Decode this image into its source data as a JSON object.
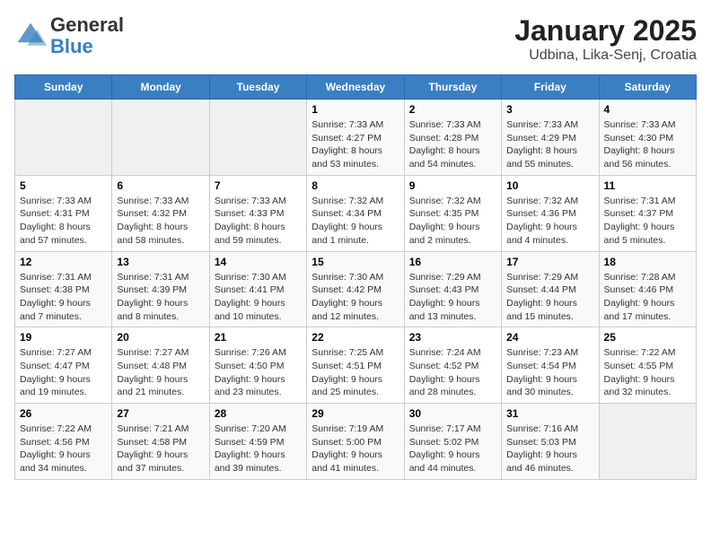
{
  "header": {
    "logo_general": "General",
    "logo_blue": "Blue",
    "title": "January 2025",
    "subtitle": "Udbina, Lika-Senj, Croatia"
  },
  "weekdays": [
    "Sunday",
    "Monday",
    "Tuesday",
    "Wednesday",
    "Thursday",
    "Friday",
    "Saturday"
  ],
  "weeks": [
    [
      {
        "day": "",
        "info": ""
      },
      {
        "day": "",
        "info": ""
      },
      {
        "day": "",
        "info": ""
      },
      {
        "day": "1",
        "info": "Sunrise: 7:33 AM\nSunset: 4:27 PM\nDaylight: 8 hours and 53 minutes."
      },
      {
        "day": "2",
        "info": "Sunrise: 7:33 AM\nSunset: 4:28 PM\nDaylight: 8 hours and 54 minutes."
      },
      {
        "day": "3",
        "info": "Sunrise: 7:33 AM\nSunset: 4:29 PM\nDaylight: 8 hours and 55 minutes."
      },
      {
        "day": "4",
        "info": "Sunrise: 7:33 AM\nSunset: 4:30 PM\nDaylight: 8 hours and 56 minutes."
      }
    ],
    [
      {
        "day": "5",
        "info": "Sunrise: 7:33 AM\nSunset: 4:31 PM\nDaylight: 8 hours and 57 minutes."
      },
      {
        "day": "6",
        "info": "Sunrise: 7:33 AM\nSunset: 4:32 PM\nDaylight: 8 hours and 58 minutes."
      },
      {
        "day": "7",
        "info": "Sunrise: 7:33 AM\nSunset: 4:33 PM\nDaylight: 8 hours and 59 minutes."
      },
      {
        "day": "8",
        "info": "Sunrise: 7:32 AM\nSunset: 4:34 PM\nDaylight: 9 hours and 1 minute."
      },
      {
        "day": "9",
        "info": "Sunrise: 7:32 AM\nSunset: 4:35 PM\nDaylight: 9 hours and 2 minutes."
      },
      {
        "day": "10",
        "info": "Sunrise: 7:32 AM\nSunset: 4:36 PM\nDaylight: 9 hours and 4 minutes."
      },
      {
        "day": "11",
        "info": "Sunrise: 7:31 AM\nSunset: 4:37 PM\nDaylight: 9 hours and 5 minutes."
      }
    ],
    [
      {
        "day": "12",
        "info": "Sunrise: 7:31 AM\nSunset: 4:38 PM\nDaylight: 9 hours and 7 minutes."
      },
      {
        "day": "13",
        "info": "Sunrise: 7:31 AM\nSunset: 4:39 PM\nDaylight: 9 hours and 8 minutes."
      },
      {
        "day": "14",
        "info": "Sunrise: 7:30 AM\nSunset: 4:41 PM\nDaylight: 9 hours and 10 minutes."
      },
      {
        "day": "15",
        "info": "Sunrise: 7:30 AM\nSunset: 4:42 PM\nDaylight: 9 hours and 12 minutes."
      },
      {
        "day": "16",
        "info": "Sunrise: 7:29 AM\nSunset: 4:43 PM\nDaylight: 9 hours and 13 minutes."
      },
      {
        "day": "17",
        "info": "Sunrise: 7:29 AM\nSunset: 4:44 PM\nDaylight: 9 hours and 15 minutes."
      },
      {
        "day": "18",
        "info": "Sunrise: 7:28 AM\nSunset: 4:46 PM\nDaylight: 9 hours and 17 minutes."
      }
    ],
    [
      {
        "day": "19",
        "info": "Sunrise: 7:27 AM\nSunset: 4:47 PM\nDaylight: 9 hours and 19 minutes."
      },
      {
        "day": "20",
        "info": "Sunrise: 7:27 AM\nSunset: 4:48 PM\nDaylight: 9 hours and 21 minutes."
      },
      {
        "day": "21",
        "info": "Sunrise: 7:26 AM\nSunset: 4:50 PM\nDaylight: 9 hours and 23 minutes."
      },
      {
        "day": "22",
        "info": "Sunrise: 7:25 AM\nSunset: 4:51 PM\nDaylight: 9 hours and 25 minutes."
      },
      {
        "day": "23",
        "info": "Sunrise: 7:24 AM\nSunset: 4:52 PM\nDaylight: 9 hours and 28 minutes."
      },
      {
        "day": "24",
        "info": "Sunrise: 7:23 AM\nSunset: 4:54 PM\nDaylight: 9 hours and 30 minutes."
      },
      {
        "day": "25",
        "info": "Sunrise: 7:22 AM\nSunset: 4:55 PM\nDaylight: 9 hours and 32 minutes."
      }
    ],
    [
      {
        "day": "26",
        "info": "Sunrise: 7:22 AM\nSunset: 4:56 PM\nDaylight: 9 hours and 34 minutes."
      },
      {
        "day": "27",
        "info": "Sunrise: 7:21 AM\nSunset: 4:58 PM\nDaylight: 9 hours and 37 minutes."
      },
      {
        "day": "28",
        "info": "Sunrise: 7:20 AM\nSunset: 4:59 PM\nDaylight: 9 hours and 39 minutes."
      },
      {
        "day": "29",
        "info": "Sunrise: 7:19 AM\nSunset: 5:00 PM\nDaylight: 9 hours and 41 minutes."
      },
      {
        "day": "30",
        "info": "Sunrise: 7:17 AM\nSunset: 5:02 PM\nDaylight: 9 hours and 44 minutes."
      },
      {
        "day": "31",
        "info": "Sunrise: 7:16 AM\nSunset: 5:03 PM\nDaylight: 9 hours and 46 minutes."
      },
      {
        "day": "",
        "info": ""
      }
    ]
  ]
}
